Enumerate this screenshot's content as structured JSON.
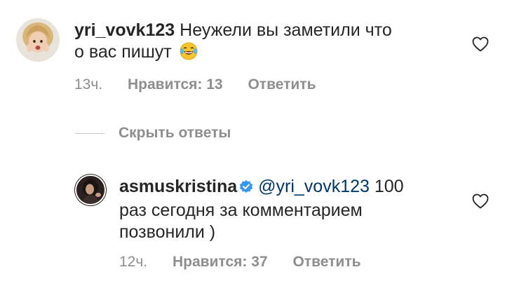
{
  "comments": [
    {
      "username": "yri_vovk123",
      "text_line1": "Неужели вы заметили что",
      "text_line2": "о вас пишут",
      "emoji": "laughing-tears-emoji",
      "time": "13ч.",
      "likes": "Нравится: 13",
      "reply": "Ответить"
    }
  ],
  "hide_replies_label": "Скрыть ответы",
  "replies": [
    {
      "username": "asmuskristina",
      "verified": true,
      "mention": "@yri_vovk123",
      "text_line1_suffix": "100",
      "text_line2": "раз сегодня за комментарием",
      "text_line3": "позвонили )",
      "time": "12ч.",
      "likes": "Нравится: 37",
      "reply": "Ответить"
    }
  ],
  "colors": {
    "text": "#262626",
    "secondary": "#8e8e8e",
    "mention": "#00376b",
    "verified": "#3897f0"
  },
  "icons": [
    "heart-icon",
    "verified-badge-icon",
    "laughing-tears-emoji"
  ]
}
